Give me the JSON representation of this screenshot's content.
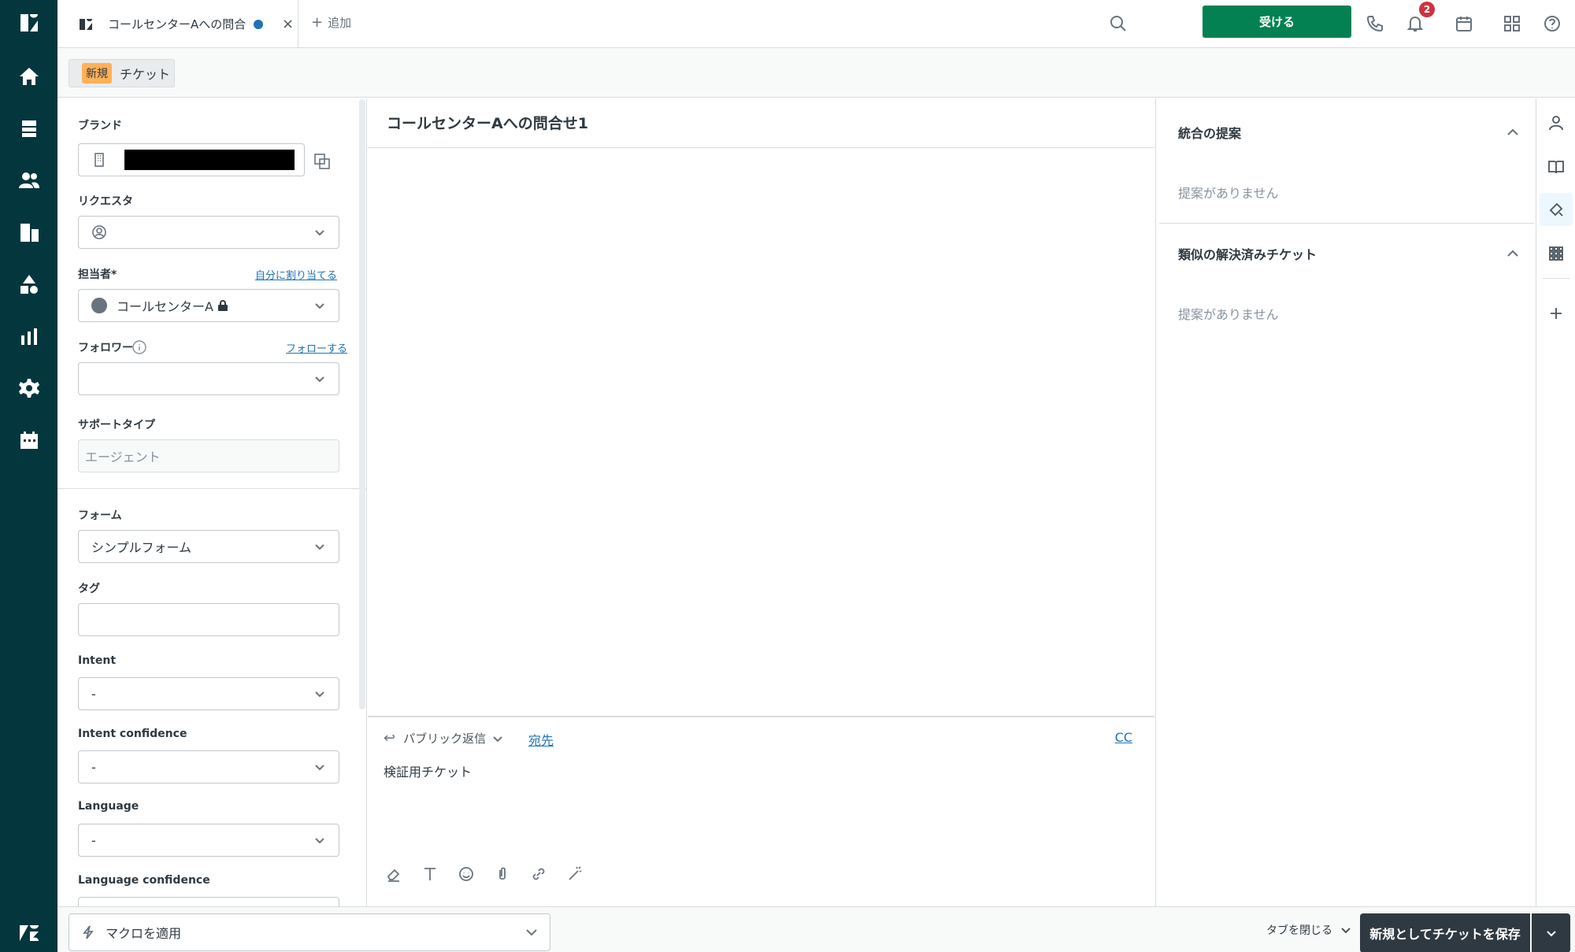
{
  "tab": {
    "title": "コールセンターAへの問合...",
    "close": "×",
    "add_label": "追加"
  },
  "topbar": {
    "accept_label": "受ける",
    "notification_count": "2"
  },
  "subbar": {
    "new_badge": "新規",
    "ticket_label": "チケット"
  },
  "fields": {
    "brand_label": "ブランド",
    "requester_label": "リクエスタ",
    "assignee_label": "担当者*",
    "assign_self_link": "自分に割り当てる",
    "assignee_value": "コールセンターA",
    "followers_label": "フォロワー",
    "follow_link": "フォローする",
    "support_type_label": "サポートタイプ",
    "support_type_value": "エージェント",
    "form_label": "フォーム",
    "form_value": "シンプルフォーム",
    "tags_label": "タグ",
    "intent_label": "Intent",
    "intent_value": "-",
    "intent_conf_label": "Intent confidence",
    "intent_conf_value": "-",
    "language_label": "Language",
    "language_value": "-",
    "language_conf_label": "Language confidence"
  },
  "center": {
    "subject": "コールセンターAへの問合せ1",
    "reply_type": "パブリック返信",
    "to_link": "宛先",
    "cc_link": "CC",
    "body": "検証用チケット"
  },
  "right": {
    "merge_title": "統合の提案",
    "merge_empty": "提案がありません",
    "similar_title": "類似の解決済みチケット",
    "similar_empty": "提案がありません"
  },
  "footer": {
    "macro_label": "マクロを適用",
    "close_tab_label": "タブを閉じる",
    "submit_label": "新規としてチケットを保存"
  },
  "colors": {
    "nav_bg": "#03363d",
    "accept_green": "#038153",
    "link_blue": "#1f73b7",
    "submit_dark": "#2f3941"
  }
}
